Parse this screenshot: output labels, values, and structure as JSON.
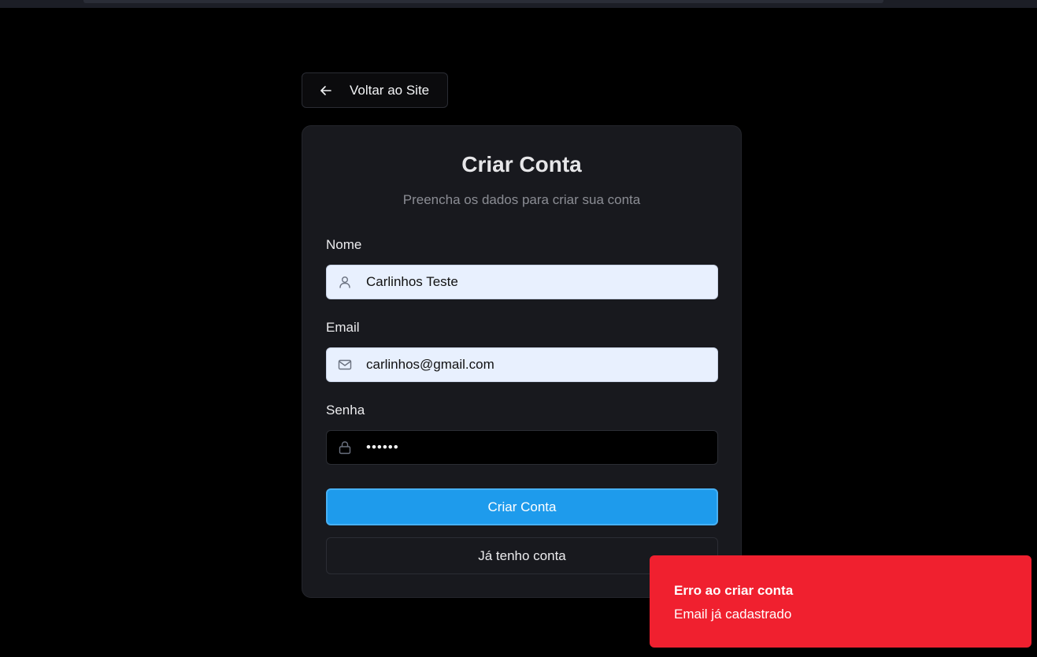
{
  "back_button": {
    "label": "Voltar ao Site",
    "icon": "arrow-left-icon"
  },
  "card": {
    "title": "Criar Conta",
    "subtitle": "Preencha os dados para criar sua conta"
  },
  "form": {
    "name": {
      "label": "Nome",
      "value": "Carlinhos Teste",
      "icon": "user-icon"
    },
    "email": {
      "label": "Email",
      "value": "carlinhos@gmail.com",
      "icon": "mail-icon"
    },
    "password": {
      "label": "Senha",
      "value": "••••••",
      "icon": "lock-icon"
    },
    "submit_label": "Criar Conta",
    "secondary_label": "Já tenho conta"
  },
  "toast": {
    "title": "Erro ao criar conta",
    "message": "Email já cadastrado",
    "color": "#f0202f"
  },
  "colors": {
    "background": "#000000",
    "card": "#18191e",
    "accent": "#1e9bec",
    "error": "#f0202f"
  }
}
